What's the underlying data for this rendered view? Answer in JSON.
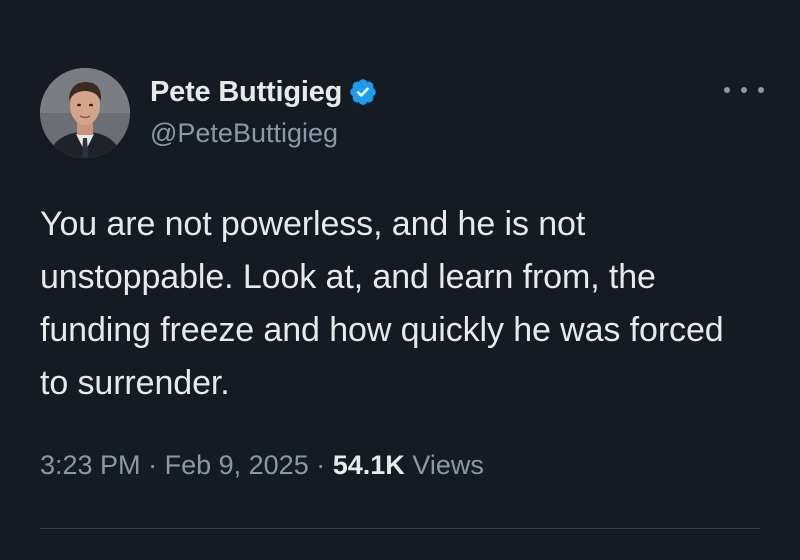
{
  "tweet": {
    "author": {
      "display_name": "Pete Buttigieg",
      "handle": "@PeteButtigieg",
      "verified": true,
      "avatar": "profile-photo"
    },
    "text": "You are not powerless, and he is not unstoppable. Look at, and learn from, the funding freeze and how quickly he was forced to surrender.",
    "time": "3:23 PM",
    "separator": "·",
    "date": "Feb 9, 2025",
    "views_count": "54.1K",
    "views_label": "Views"
  },
  "icons": {
    "more": "more-options-icon",
    "verified": "verified-badge-icon"
  },
  "colors": {
    "background": "#151b23",
    "primary_text": "#e7e9ea",
    "secondary_text": "#8b98a5",
    "verified_blue": "#1d9bf0",
    "divider": "#38444d"
  }
}
